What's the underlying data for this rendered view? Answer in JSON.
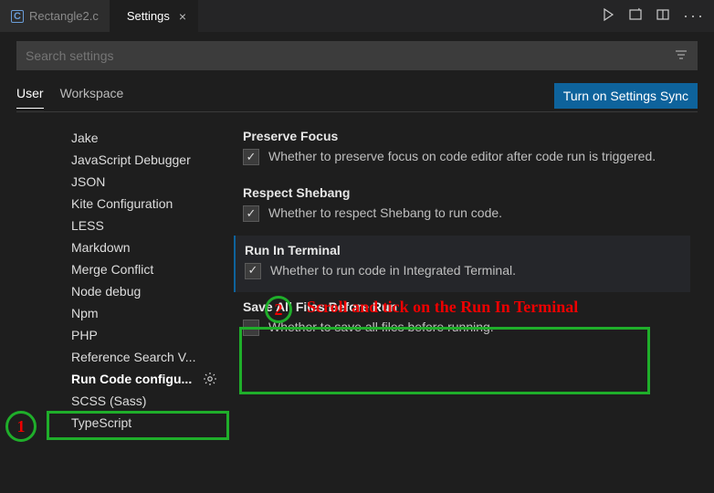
{
  "tabs": {
    "inactive_label": "Rectangle2.c",
    "active_label": "Settings"
  },
  "search": {
    "placeholder": "Search settings"
  },
  "scopes": {
    "user": "User",
    "workspace": "Workspace"
  },
  "sync_button": "Turn on Settings Sync",
  "sidebar": {
    "items": [
      "Jake",
      "JavaScript Debugger",
      "JSON",
      "Kite Configuration",
      "LESS",
      "Markdown",
      "Merge Conflict",
      "Node debug",
      "Npm",
      "PHP",
      "Reference Search V...",
      "Run Code configu...",
      "SCSS (Sass)",
      "TypeScript"
    ]
  },
  "settings": {
    "preserve_focus": {
      "title": "Preserve Focus",
      "desc": "Whether to preserve focus on code editor after code run is triggered."
    },
    "respect_shebang": {
      "title": "Respect Shebang",
      "desc": "Whether to respect Shebang to run code."
    },
    "run_in_terminal": {
      "title": "Run In Terminal",
      "desc": "Whether to run code in Integrated Terminal."
    },
    "save_all": {
      "title": "Save All Files Before Run",
      "desc": "Whether to save all files before running."
    }
  },
  "annotations": {
    "step1": "1",
    "step2": "2",
    "step2_text": "Scroll and tick on the Run In Terminal"
  }
}
